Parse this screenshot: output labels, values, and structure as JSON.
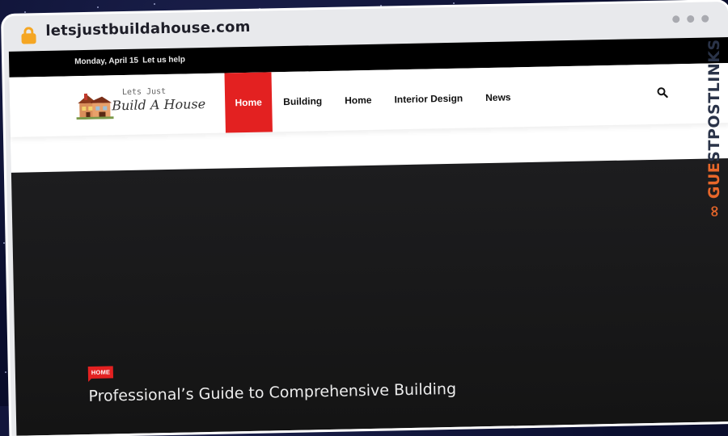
{
  "browser": {
    "url": "letsjustbuildahouse.com",
    "window_controls": [
      "dot",
      "dot",
      "dot"
    ]
  },
  "topbar": {
    "date": "Monday, April 15",
    "help_link": "Let us help"
  },
  "logo": {
    "line1": "Lets Just",
    "line2": "Build A House"
  },
  "nav": {
    "items": [
      {
        "label": "Home",
        "active": true
      },
      {
        "label": "Building",
        "active": false
      },
      {
        "label": "Home",
        "active": false
      },
      {
        "label": "Interior Design",
        "active": false
      },
      {
        "label": "News",
        "active": false
      }
    ],
    "search_icon": "search-icon"
  },
  "hero": {
    "category_badge": "HOME",
    "headline": "Professional’s Guide to Comprehensive Building"
  },
  "watermark": {
    "prefix": "GUE",
    "rest": "STPOSTLINKS",
    "icon": "chain-link-icon"
  },
  "colors": {
    "accent": "#e32121",
    "lock": "#f5a623",
    "watermark_orange": "#e8672a",
    "watermark_navy": "#2a3348"
  }
}
